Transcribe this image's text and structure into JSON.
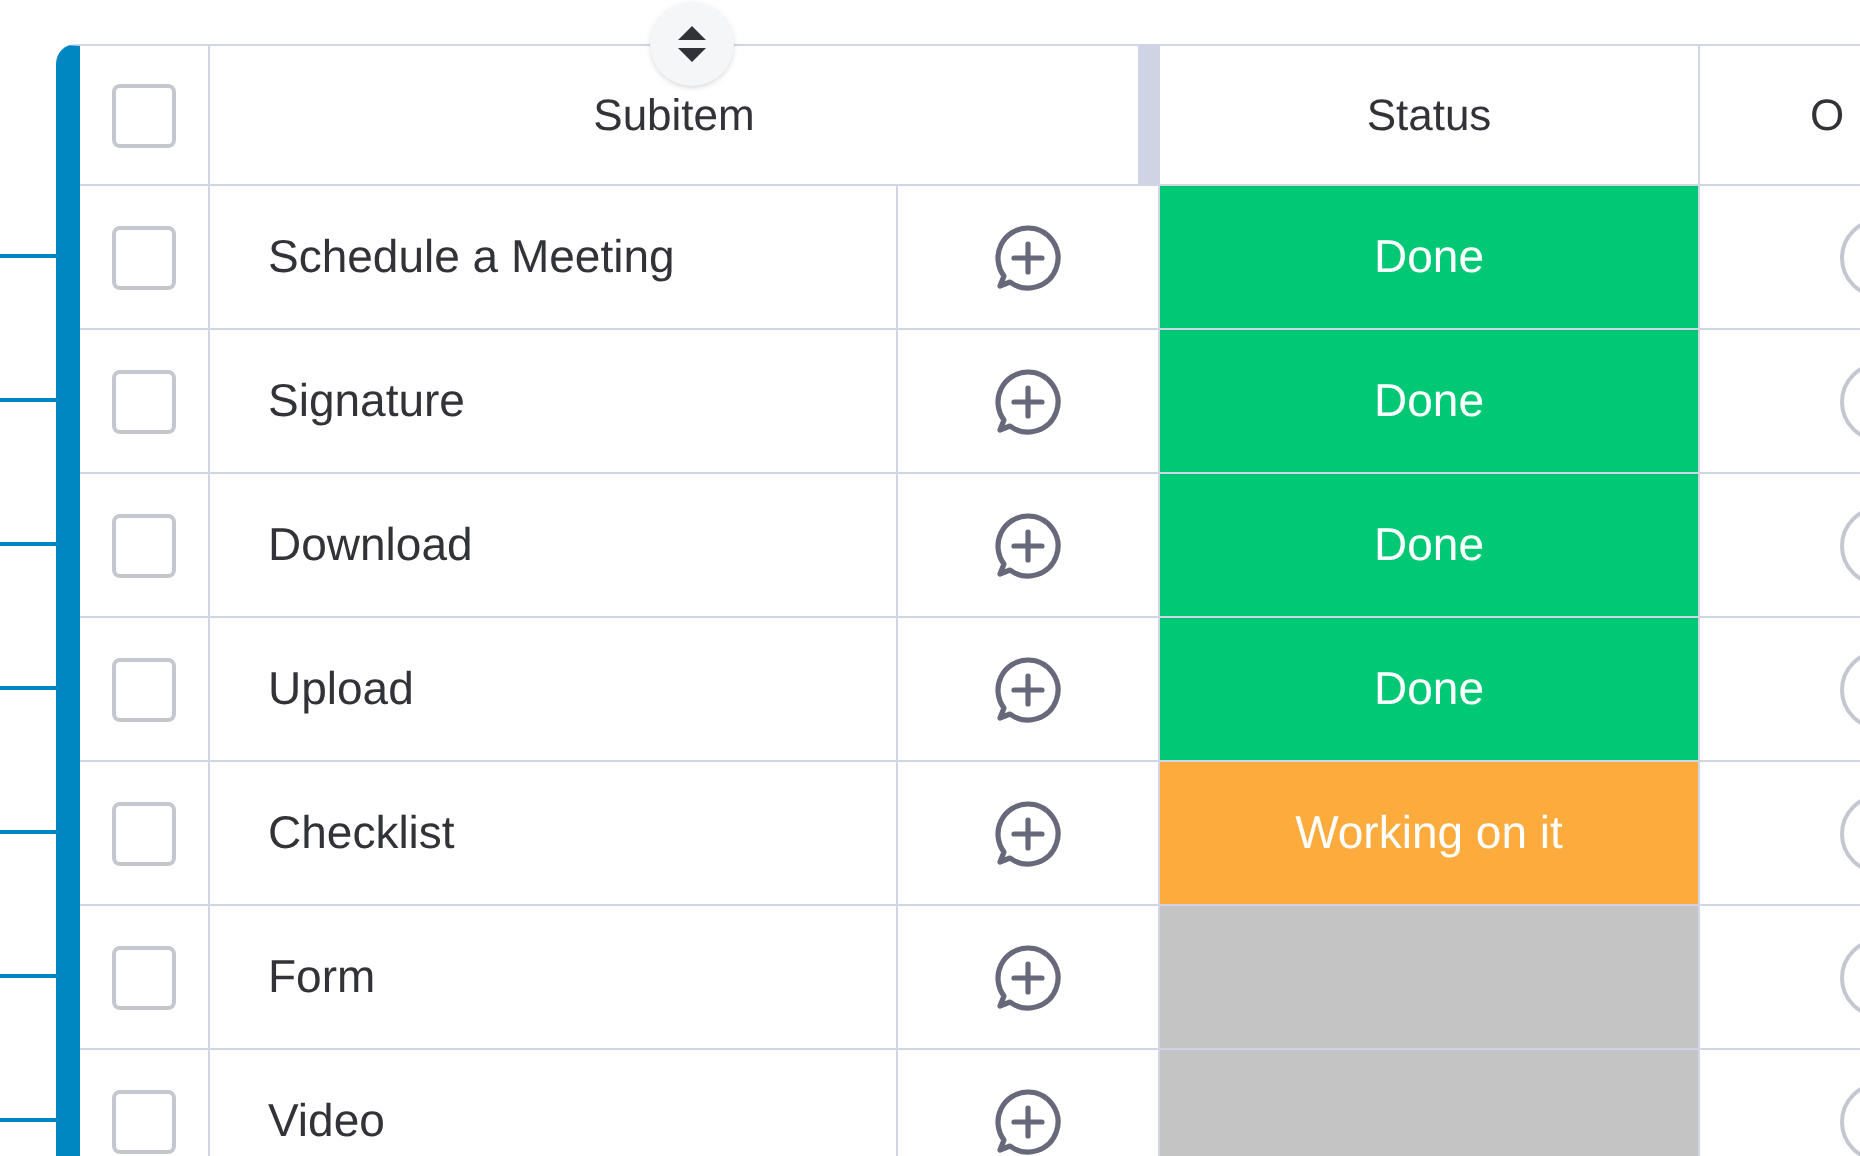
{
  "header": {
    "checkbox": {
      "checked": false
    },
    "columns": [
      "Subitem",
      "Status",
      "O"
    ]
  },
  "rows": [
    {
      "checked": false,
      "name": "Schedule a Meeting",
      "status": {
        "label": "Done",
        "color": "#00c875"
      }
    },
    {
      "checked": false,
      "name": "Signature",
      "status": {
        "label": "Done",
        "color": "#00c875"
      }
    },
    {
      "checked": false,
      "name": "Download",
      "status": {
        "label": "Done",
        "color": "#00c875"
      }
    },
    {
      "checked": false,
      "name": "Upload",
      "status": {
        "label": "Done",
        "color": "#00c875"
      }
    },
    {
      "checked": false,
      "name": "Checklist",
      "status": {
        "label": "Working on it",
        "color": "#fdab3d"
      }
    },
    {
      "checked": false,
      "name": "Form",
      "status": {
        "color": "#c4c4c4"
      }
    },
    {
      "checked": false,
      "name": "Video",
      "status": {
        "color": "#c4c4c4"
      }
    }
  ]
}
